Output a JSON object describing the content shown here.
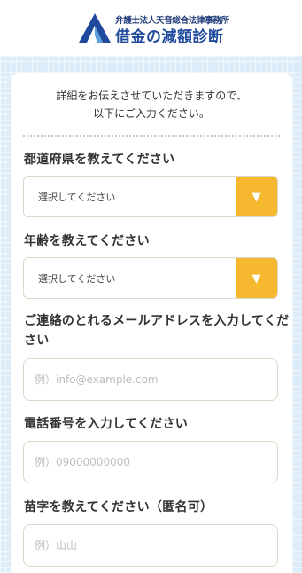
{
  "header": {
    "firm_name": "弁護士法人天音総合法律事務所",
    "site_title": "借金の減額診断",
    "logo_icon": "logo-a-mark-icon",
    "brand_color": "#1f4a9c"
  },
  "intro": {
    "line1": "詳細をお伝えさせていただきますので、",
    "line2": "以下にご入力ください。"
  },
  "form": {
    "prefecture": {
      "label": "都道府県を教えてください",
      "value": "選択してください",
      "arrow": "▼"
    },
    "age": {
      "label": "年齢を教えてください",
      "value": "選択してください",
      "arrow": "▼"
    },
    "email": {
      "label": "ご連絡のとれるメールアドレスを入力してください",
      "placeholder": "例）info@example.com"
    },
    "phone": {
      "label": "電話番号を入力してください",
      "placeholder": "例）09000000000"
    },
    "surname": {
      "label": "苗字を教えてください（匿名可）",
      "placeholder": "例）山山"
    }
  },
  "colors": {
    "accent": "#f5b82e",
    "background": "#dcecf9",
    "input_border": "#d9d9c8"
  }
}
